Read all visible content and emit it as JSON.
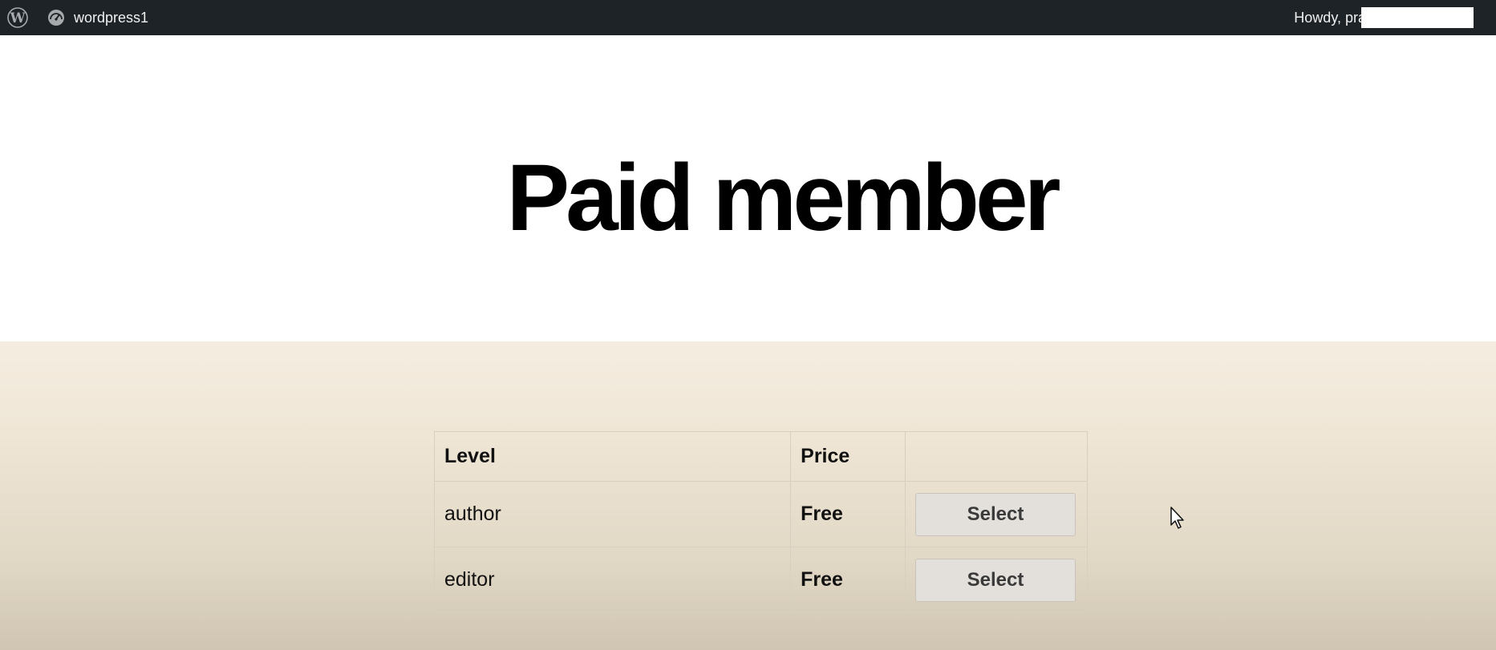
{
  "adminbar": {
    "site_name": "wordpress1",
    "howdy": "Howdy, pra"
  },
  "page": {
    "title": "Paid member"
  },
  "levels_table": {
    "headers": [
      "Level",
      "Price",
      ""
    ],
    "rows": [
      {
        "level": "author",
        "price": "Free",
        "action": "Select"
      },
      {
        "level": "editor",
        "price": "Free",
        "action": "Select"
      }
    ]
  },
  "icons": [
    "wordpress-logo-icon",
    "dashboard-gauge-icon",
    "mouse-cursor-icon"
  ],
  "colors": {
    "adminbar_bg": "#1d2327",
    "content_bg_top": "#f5ede0",
    "content_bg_bottom": "#cfc5b2"
  }
}
